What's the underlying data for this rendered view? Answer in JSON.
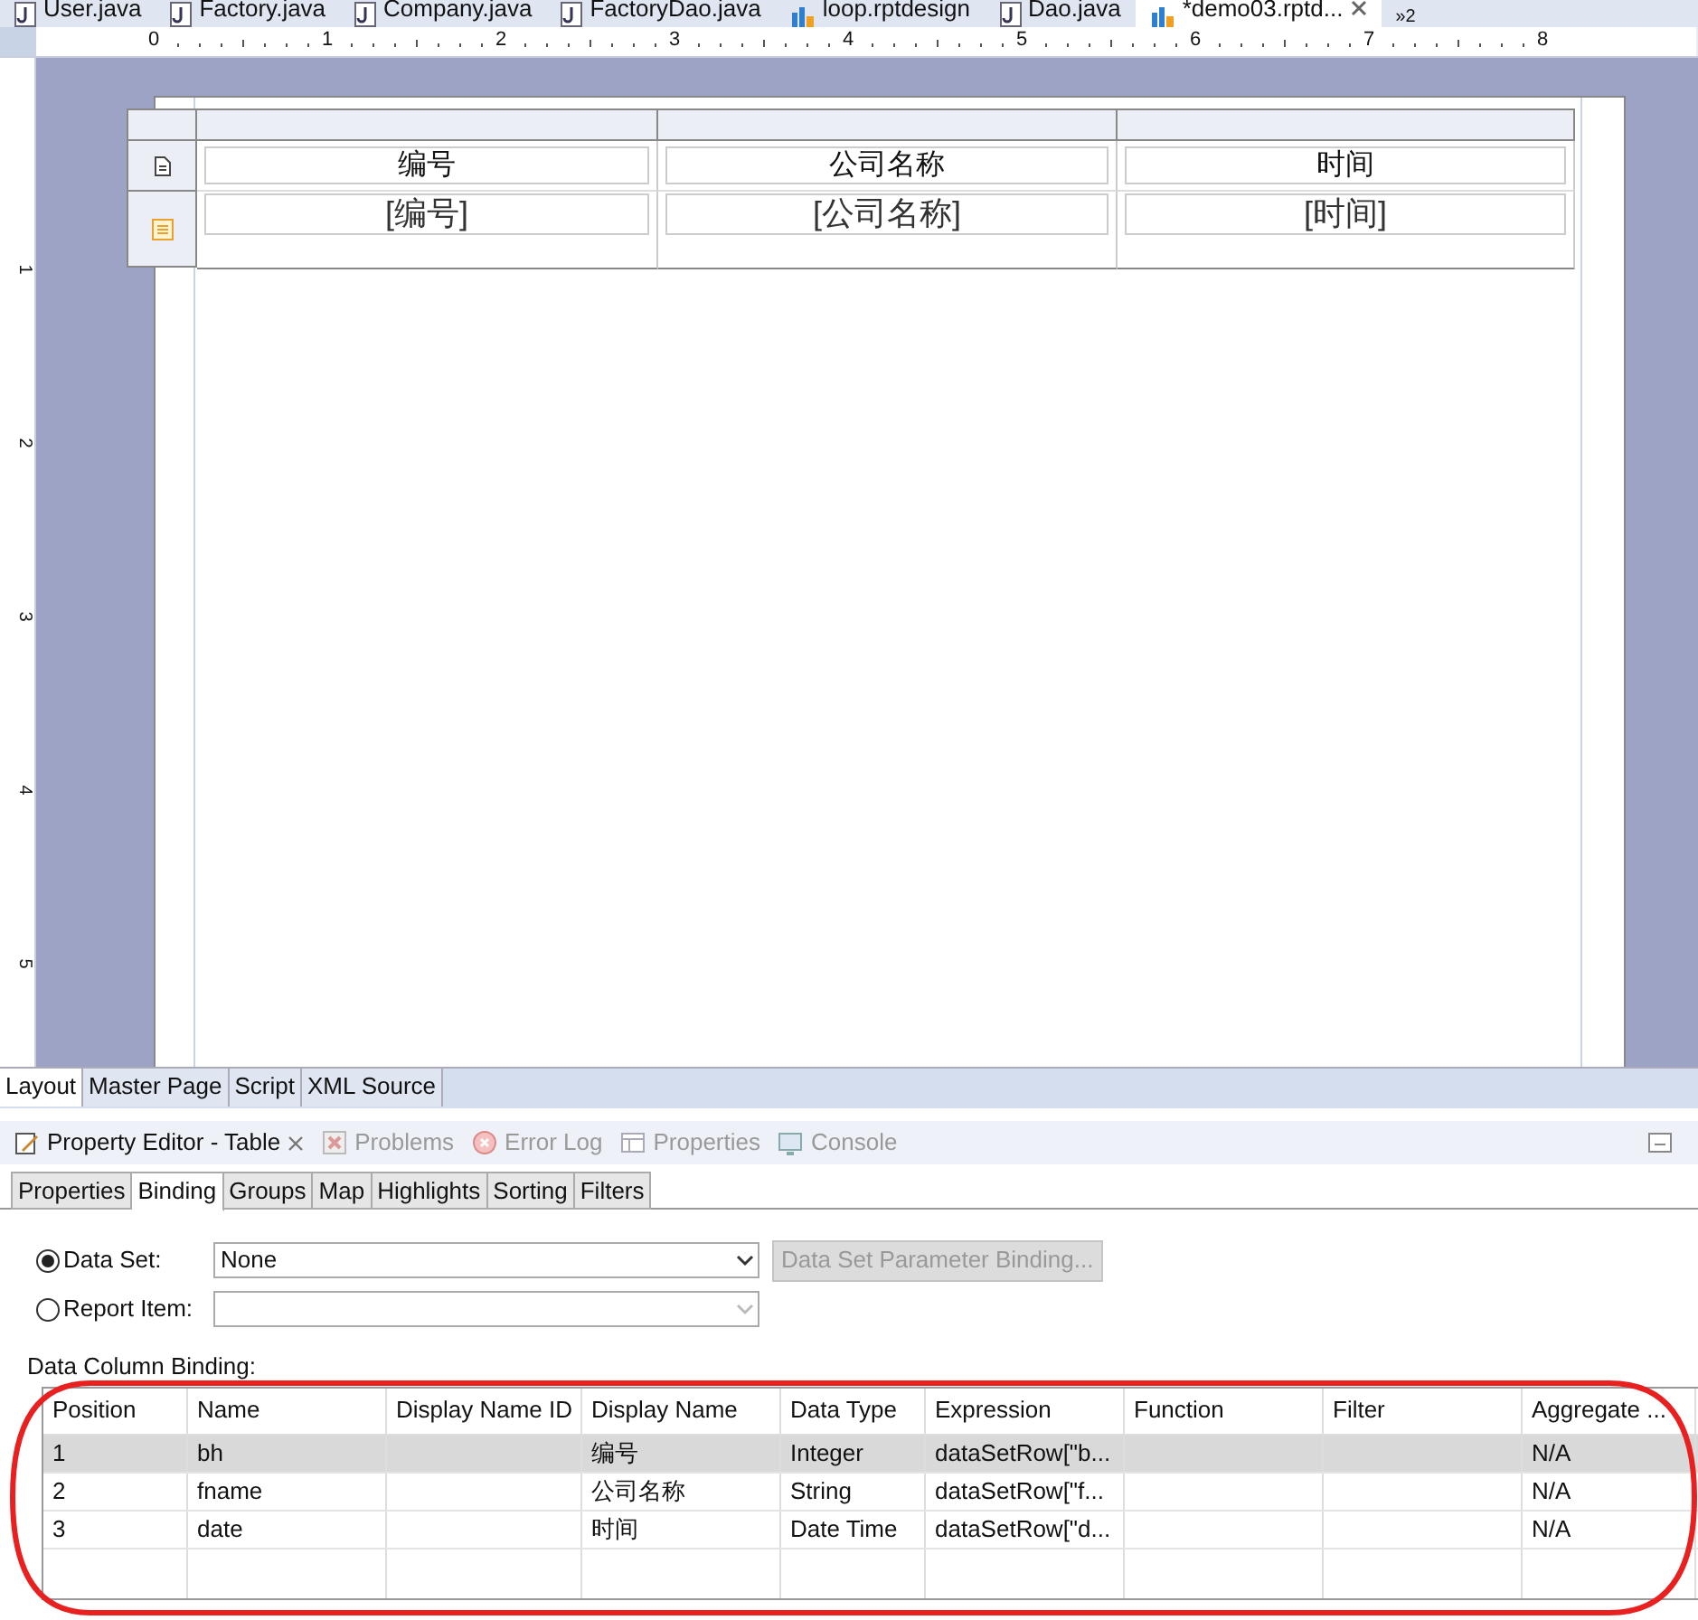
{
  "editor_tabs": [
    {
      "label": "User.java",
      "kind": "java",
      "selected": false
    },
    {
      "label": "Factory.java",
      "kind": "java",
      "selected": false
    },
    {
      "label": "Company.java",
      "kind": "java",
      "selected": false
    },
    {
      "label": "FactoryDao.java",
      "kind": "java",
      "selected": false
    },
    {
      "label": "loop.rptdesign",
      "kind": "report",
      "selected": false
    },
    {
      "label": "Dao.java",
      "kind": "java",
      "selected": false
    },
    {
      "label": "*demo03.rptd...",
      "kind": "report",
      "selected": true
    }
  ],
  "overflow": {
    "mark": "»",
    "count": "2"
  },
  "ruler": {
    "marks": [
      "0",
      "1",
      "2",
      "3",
      "4",
      "5",
      "6",
      "7",
      "8"
    ],
    "vertical_marks": [
      "1",
      "2",
      "3",
      "4",
      "5"
    ]
  },
  "report_table": {
    "header": [
      "编号",
      "公司名称",
      "时间"
    ],
    "detail": [
      "[编号]",
      "[公司名称]",
      "[时间]"
    ]
  },
  "page_tabs": [
    {
      "label": "Layout",
      "selected": true
    },
    {
      "label": "Master Page",
      "selected": false
    },
    {
      "label": "Script",
      "selected": false
    },
    {
      "label": "XML Source",
      "selected": false
    }
  ],
  "views": [
    {
      "label": "Property Editor - Table",
      "kind": "editor",
      "selected": true
    },
    {
      "label": "Problems",
      "kind": "problems",
      "selected": false
    },
    {
      "label": "Error Log",
      "kind": "log",
      "selected": false
    },
    {
      "label": "Properties",
      "kind": "properties",
      "selected": false
    },
    {
      "label": "Console",
      "kind": "console",
      "selected": false
    }
  ],
  "property_tabs": [
    {
      "label": "Properties",
      "selected": false
    },
    {
      "label": "Binding",
      "selected": true
    },
    {
      "label": "Groups",
      "selected": false
    },
    {
      "label": "Map",
      "selected": false
    },
    {
      "label": "Highlights",
      "selected": false
    },
    {
      "label": "Sorting",
      "selected": false
    },
    {
      "label": "Filters",
      "selected": false
    }
  ],
  "binding": {
    "options": [
      {
        "label": "Data Set:",
        "selected": true,
        "value": "None",
        "disabled": false
      },
      {
        "label": "Report Item:",
        "selected": false,
        "disabled": true
      }
    ],
    "parameter_button": "Data Set Parameter Binding...",
    "section_label": "Data Column Binding:",
    "columns": [
      "Position",
      "Name",
      "Display Name ID",
      "Display Name",
      "Data Type",
      "Expression",
      "Function",
      "Filter",
      "Aggregate ..."
    ],
    "rows": [
      {
        "selected": true,
        "cells": [
          "1",
          "bh",
          "",
          "编号",
          "Integer",
          "dataSetRow[\"b...",
          "",
          "",
          "N/A"
        ]
      },
      {
        "selected": false,
        "cells": [
          "2",
          "fname",
          "",
          "公司名称",
          "String",
          "dataSetRow[\"f...",
          "",
          "",
          "N/A"
        ]
      },
      {
        "selected": false,
        "cells": [
          "3",
          "date",
          "",
          "时间",
          "Date Time",
          "dataSetRow[\"d...",
          "",
          "",
          "N/A"
        ]
      }
    ]
  }
}
